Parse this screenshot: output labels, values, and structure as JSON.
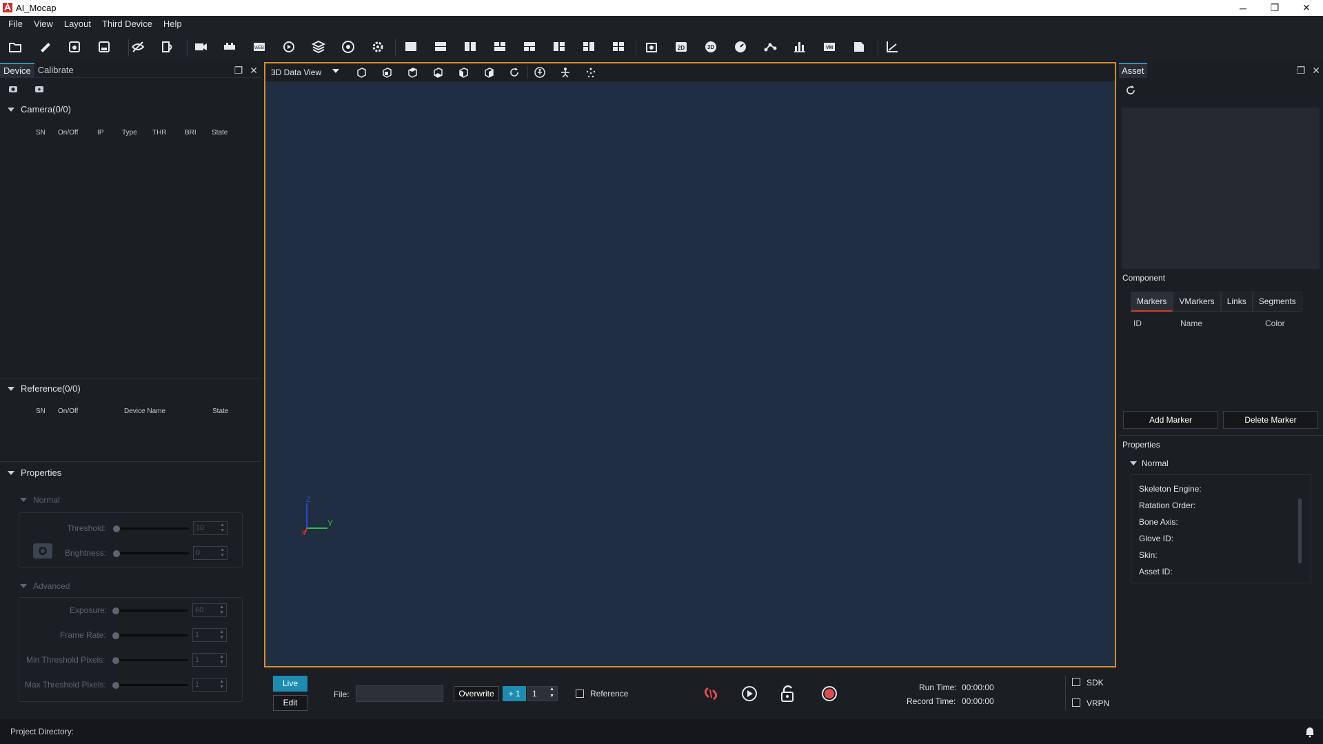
{
  "window": {
    "title": "AI_Mocap",
    "controls": [
      "minimize",
      "maximize",
      "close"
    ]
  },
  "menu": [
    "File",
    "View",
    "Layout",
    "Third Device",
    "Help"
  ],
  "toolbar": {
    "icons": [
      "open-folder-icon",
      "ruler-icon",
      "save-icon",
      "save-as-icon",
      "visibility-off-icon",
      "import-icon",
      "video-icon",
      "device-bar-icon",
      "web-icon",
      "play-circle-icon",
      "layers-icon",
      "broadcast-icon",
      "settings-gear-icon",
      "layout-single-icon",
      "layout-rows-icon",
      "layout-cols-icon",
      "layout-grid-icon",
      "layout-tri-icon",
      "layout-split-icon",
      "layout-quad-a-icon",
      "layout-quad-b-icon",
      "capture-icon",
      "view-2d-icon",
      "view-3d-icon",
      "gauge-icon",
      "skeleton-link-icon",
      "bar-chart-icon",
      "vm-icon",
      "document-icon",
      "graph-axis-icon"
    ]
  },
  "left_panel": {
    "tabs": [
      "Device",
      "Calibrate"
    ],
    "camera": {
      "title": "Camera(0/0)",
      "columns": [
        "SN",
        "On/Off",
        "IP",
        "Type",
        "THR",
        "BRI",
        "State"
      ]
    },
    "reference": {
      "title": "Reference(0/0)",
      "columns": [
        "SN",
        "On/Off",
        "Device Name",
        "State"
      ]
    },
    "properties": {
      "title": "Properties",
      "normal": {
        "title": "Normal",
        "threshold_label": "Threshold:",
        "threshold_value": "10",
        "brightness_label": "Brightness:",
        "brightness_value": "0"
      },
      "advanced": {
        "title": "Advanced",
        "exposure_label": "Exposure:",
        "exposure_value": "60",
        "frame_rate_label": "Frame Rate:",
        "frame_rate_value": "1",
        "min_thr_label": "Min Threshold Pixels:",
        "min_thr_value": "1",
        "max_thr_label": "Max Threshold Pixels:",
        "max_thr_value": "1"
      }
    }
  },
  "view": {
    "mode": "3D Data View",
    "axes": {
      "z": "Z",
      "y": "Y",
      "x": "X"
    }
  },
  "controls": {
    "live": "Live",
    "edit": "Edit",
    "file_label": "File:",
    "file_value": "",
    "overwrite": "Overwrite",
    "plus_one": "+ 1",
    "counter": "1",
    "reference": "Reference",
    "run_time_label": "Run Time:",
    "run_time": "00:00:00",
    "record_time_label": "Record Time:",
    "record_time": "00:00:00",
    "sdk": "SDK",
    "vrpn": "VRPN"
  },
  "right_panel": {
    "tab": "Asset",
    "component_label": "Component",
    "component_tabs": [
      "Markers",
      "VMarkers",
      "Links",
      "Segments"
    ],
    "marker_columns": [
      "ID",
      "Name",
      "Color"
    ],
    "add_marker": "Add Marker",
    "delete_marker": "Delete Marker",
    "properties_label": "Properties",
    "normal_label": "Normal",
    "fields": [
      "Skeleton Engine:",
      "Ratation Order:",
      "Bone Axis:",
      "Glove ID:",
      "Skin:",
      "Asset ID:"
    ]
  },
  "status": {
    "project_directory": "Project Directory:"
  },
  "colors": {
    "accent_orange": "#d98c2b",
    "accent_blue": "#3a8fb7",
    "viewport_bg": "#1f2e41",
    "record_red": "#e24b4b",
    "live_teal": "#1d8cb0"
  }
}
